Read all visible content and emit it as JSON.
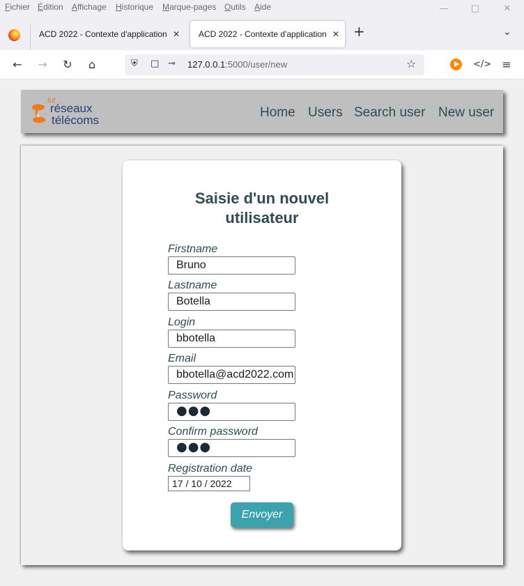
{
  "browser": {
    "menu": [
      "Fichier",
      "Édition",
      "Affichage",
      "Historique",
      "Marque-pages",
      "Outils",
      "Aide"
    ],
    "tabs": [
      {
        "label": "ACD 2022 - Contexte d'application",
        "active": false
      },
      {
        "label": "ACD 2022 - Contexte d'application",
        "active": true
      }
    ],
    "url_host": "127.0.0.1",
    "url_path": ":5000/user/new"
  },
  "site": {
    "logo": {
      "prefix": "iut",
      "line1": "réseaux",
      "line2": "télécoms",
      "amp": "&"
    },
    "nav": [
      "Home",
      "Users",
      "Search user",
      "New user"
    ]
  },
  "form": {
    "title_line1": "Saisie d'un nouvel",
    "title_line2": "utilisateur",
    "fields": [
      {
        "label": "Firstname",
        "value": "Bruno"
      },
      {
        "label": "Lastname",
        "value": "Botella"
      },
      {
        "label": "Login",
        "value": "bbotella"
      },
      {
        "label": "Email",
        "value": "bbotella@acd2022.com"
      },
      {
        "label": "Password",
        "value": "●●●"
      },
      {
        "label": "Confirm password",
        "value": "●●●"
      },
      {
        "label": "Registration date",
        "value": "17 / 10 / 2022"
      }
    ],
    "submit_label": "Envoyer"
  },
  "colors": {
    "accent_text": "#2e4b55",
    "button": "#3ba3ad",
    "header_bg": "#bfbfbf",
    "logo_orange": "#f07a1a",
    "logo_blue": "#2a3f78"
  }
}
